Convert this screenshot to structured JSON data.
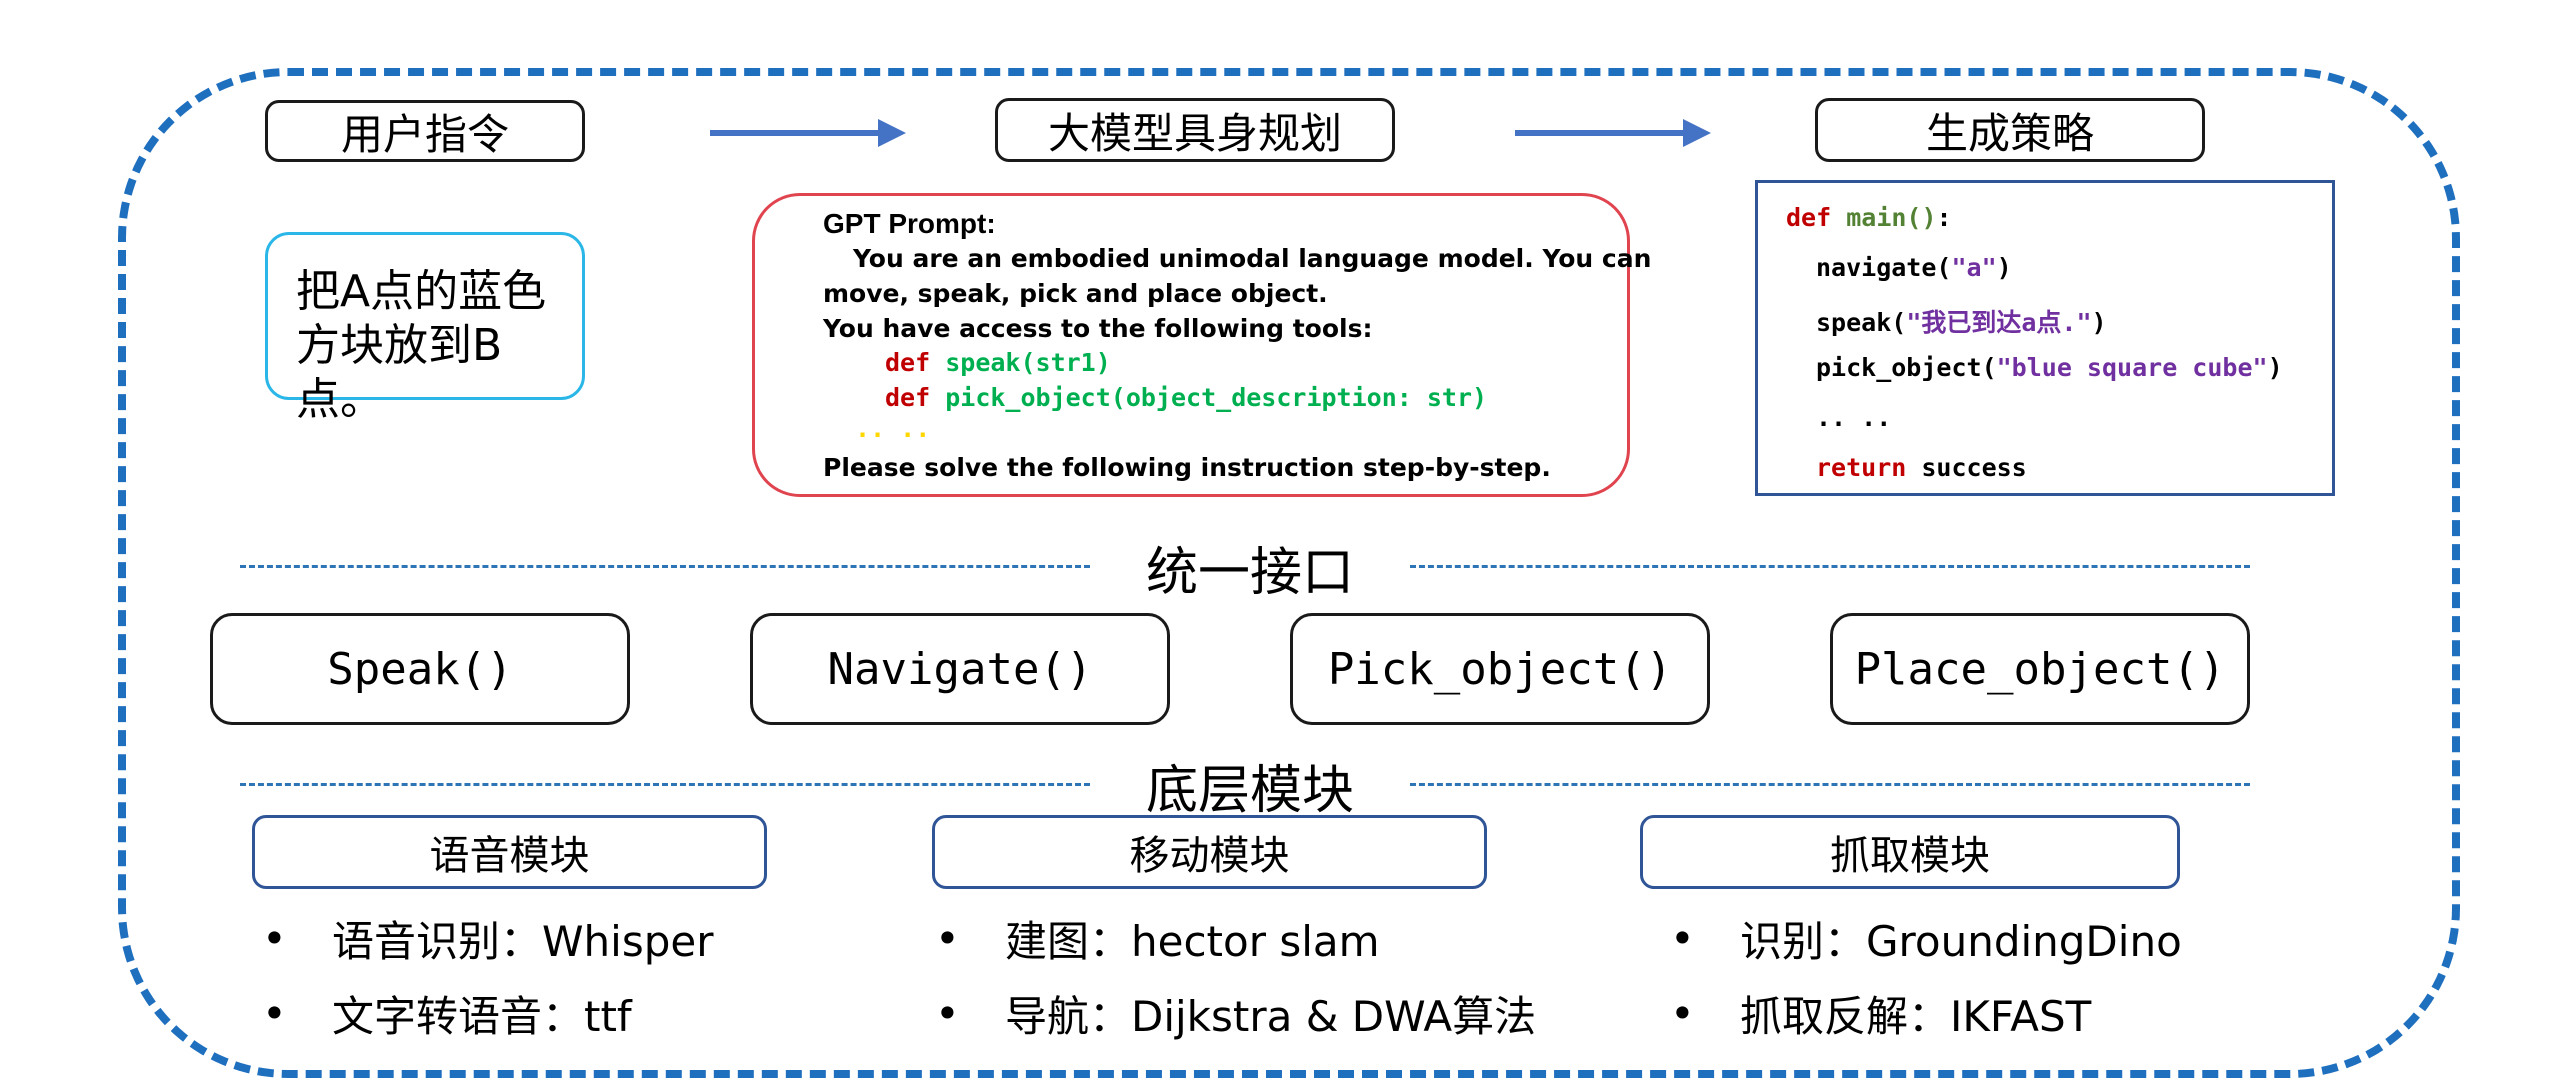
{
  "top": {
    "user_instruction": "用户指令",
    "llm_planning": "大模型具身规划",
    "policy_generation": "生成策略"
  },
  "user_box": {
    "line1": "把A点的蓝色",
    "line2": "方块放到B点。"
  },
  "prompt": {
    "title": "GPT Prompt:",
    "line1": "You are an embodied unimodal language model. You can",
    "line2": "move, speak, pick and place object.",
    "line3": "You have access to the following tools:",
    "tool1_kw": "def",
    "tool1": "speak(str1)",
    "tool2_kw": "def",
    "tool2": "pick_object(object_description: str)",
    "ellipsis": ".. ..",
    "line4": "Please solve the following instruction step-by-step."
  },
  "policy_code": {
    "def_kw": "def",
    "main": "main()",
    "colon": ":",
    "nav_fn": "navigate(",
    "nav_arg": "\"a\"",
    "nav_end": ")",
    "speak_fn": "speak(",
    "speak_arg": "\"我已到达a点.\"",
    "speak_end": ")",
    "pick_fn": "pick_object(",
    "pick_arg": "\"blue square cube\"",
    "pick_end": ")",
    "ellipsis": ".. ..",
    "return_kw": "return",
    "return_val": "success"
  },
  "unified_interface": {
    "title": "统一接口",
    "speak": "Speak()",
    "navigate": "Navigate()",
    "pick": "Pick_object()",
    "place": "Place_object()"
  },
  "modules": {
    "title": "底层模块",
    "speech": {
      "title": "语音模块",
      "items": [
        "语音识别：Whisper",
        "文字转语音：ttf"
      ]
    },
    "motion": {
      "title": "移动模块",
      "items": [
        "建图：hector slam",
        "导航：Dijkstra & DWA算法"
      ]
    },
    "grasp": {
      "title": "抓取模块",
      "items": [
        "识别：GroundingDino",
        "抓取反解：IKFAST"
      ]
    }
  },
  "colors": {
    "outer_border": "#1f6fbf",
    "arrow": "#4472c4",
    "user_box_border": "#2ab7e8",
    "prompt_box_border": "#e0444f",
    "keyword": "#c00000",
    "tool_fn": "#00b050",
    "string": "#7030a0"
  }
}
